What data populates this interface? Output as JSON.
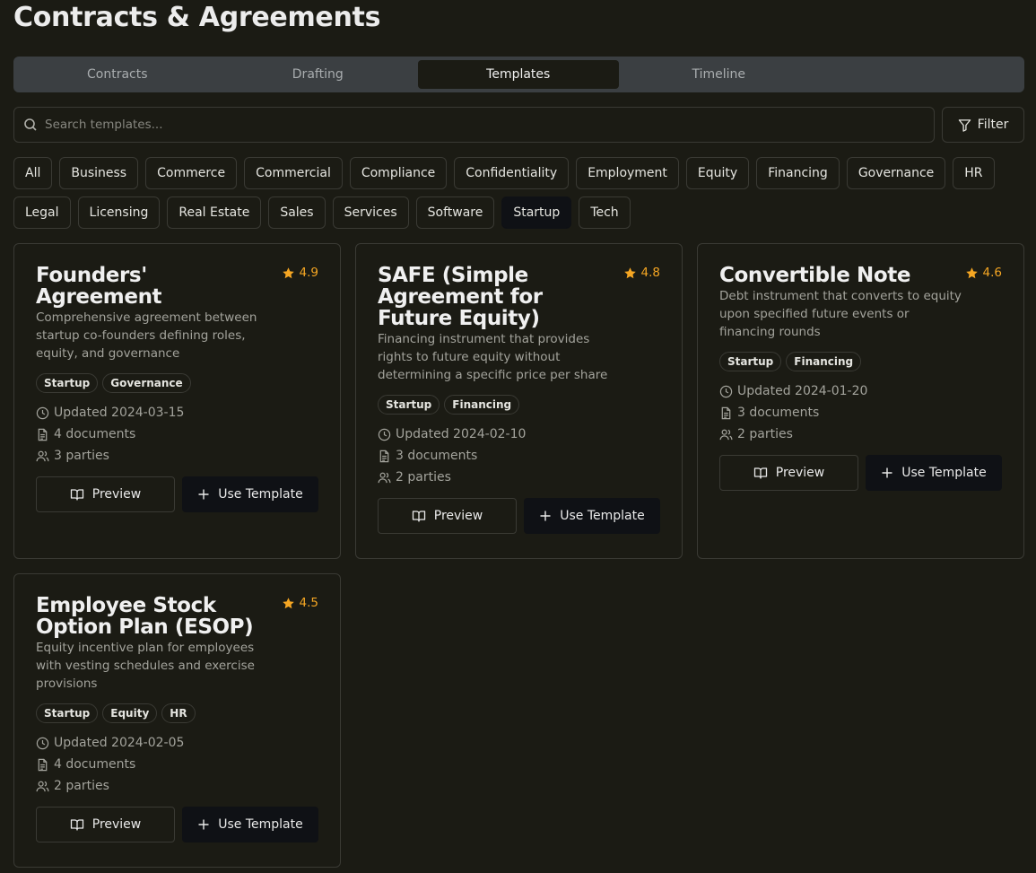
{
  "page": {
    "title": "Contracts & Agreements"
  },
  "tabs": [
    {
      "label": "Contracts"
    },
    {
      "label": "Drafting"
    },
    {
      "label": "Templates",
      "active": true
    },
    {
      "label": "Timeline"
    }
  ],
  "search": {
    "placeholder": "Search templates..."
  },
  "filter": {
    "label": "Filter"
  },
  "categories": {
    "row1": [
      "All",
      "Business",
      "Commerce",
      "Commercial",
      "Compliance",
      "Confidentiality",
      "Employment",
      "Equity",
      "Financing",
      "Governance",
      "HR"
    ],
    "row2": [
      "Legal",
      "Licensing",
      "Real Estate",
      "Sales",
      "Services",
      "Software",
      "Startup",
      "Tech"
    ],
    "selected": "Startup"
  },
  "templates": [
    {
      "title": "Founders' Agreement",
      "rating": "4.9",
      "description": "Comprehensive agreement between startup co-founders defining roles, equity, and governance",
      "tags": [
        "Startup",
        "Governance"
      ],
      "updated": "Updated 2024-03-15",
      "documents": "4 documents",
      "parties": "3 parties"
    },
    {
      "title": "SAFE (Simple Agreement for Future Equity)",
      "rating": "4.8",
      "description": "Financing instrument that provides rights to future equity without determining a specific price per share",
      "tags": [
        "Startup",
        "Financing"
      ],
      "updated": "Updated 2024-02-10",
      "documents": "3 documents",
      "parties": "2 parties"
    },
    {
      "title": "Convertible Note",
      "rating": "4.6",
      "description": "Debt instrument that converts to equity upon specified future events or financing rounds",
      "tags": [
        "Startup",
        "Financing"
      ],
      "updated": "Updated 2024-01-20",
      "documents": "3 documents",
      "parties": "2 parties"
    },
    {
      "title": "Employee Stock Option Plan (ESOP)",
      "rating": "4.5",
      "description": "Equity incentive plan for employees with vesting schedules and exercise provisions",
      "tags": [
        "Startup",
        "Equity",
        "HR"
      ],
      "updated": "Updated 2024-02-05",
      "documents": "4 documents",
      "parties": "2 parties"
    }
  ],
  "actions": {
    "preview_label": "Preview",
    "use_label": "Use Template"
  },
  "colors": {
    "background": "#1b1b14",
    "accent_star": "#f5a623",
    "tab_bar": "#3b3f42",
    "active": "#0f1115"
  }
}
